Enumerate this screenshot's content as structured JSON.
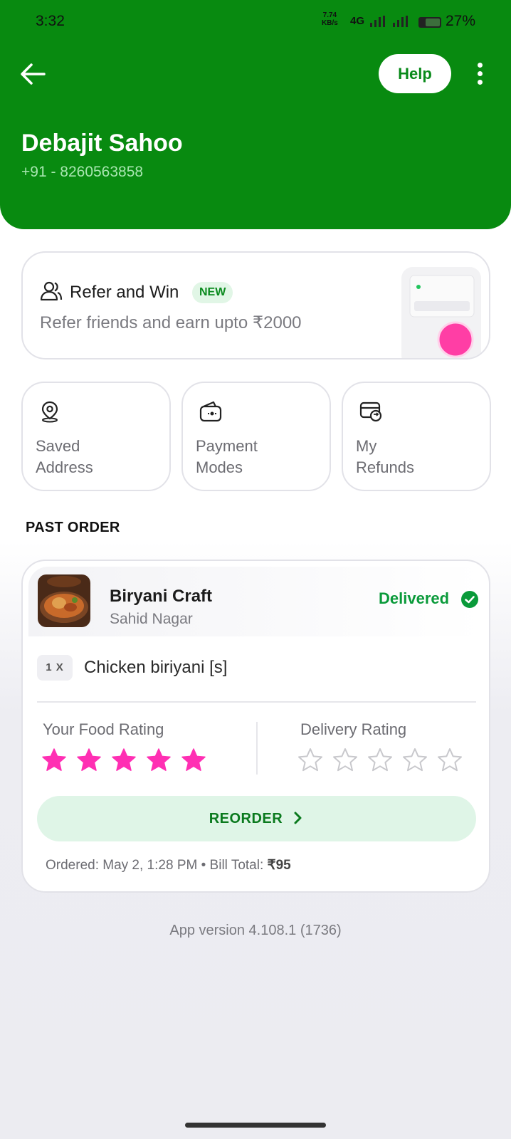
{
  "status_bar": {
    "time": "3:32",
    "speed_value": "7.74",
    "speed_unit": "KB/s",
    "network": "4G",
    "battery": "27%"
  },
  "header": {
    "help_label": "Help",
    "user_name": "Debajit Sahoo",
    "user_phone": "+91 - 8260563858",
    "background_color": "#088a10"
  },
  "refer": {
    "title": "Refer and Win",
    "badge": "NEW",
    "subtitle": "Refer friends and earn upto ₹2000"
  },
  "quick_links": [
    {
      "line1": "Saved",
      "line2": "Address",
      "icon": "location-pin-icon"
    },
    {
      "line1": "Payment",
      "line2": "Modes",
      "icon": "wallet-icon"
    },
    {
      "line1": "My",
      "line2": "Refunds",
      "icon": "refund-icon"
    }
  ],
  "past_order": {
    "section_title": "PAST ORDER",
    "restaurant": "Biryani Craft",
    "area": "Sahid Nagar",
    "status": "Delivered",
    "quantity": "1 X",
    "item": "Chicken biriyani [s]",
    "food_rating_label": "Your Food Rating",
    "delivery_rating_label": "Delivery Rating",
    "food_rating": 5,
    "delivery_rating": 0,
    "rating_max": 5,
    "reorder_label": "REORDER",
    "ordered_text": "Ordered: May 2, 1:28 PM",
    "bill_label": "Bill Total:",
    "bill_total": "₹95"
  },
  "footer": {
    "app_version": "App version 4.108.1 (1736)"
  },
  "colors": {
    "accent_green": "#0a9a3a",
    "star_filled": "#ff2fb3",
    "star_empty": "#c8c8cc"
  }
}
